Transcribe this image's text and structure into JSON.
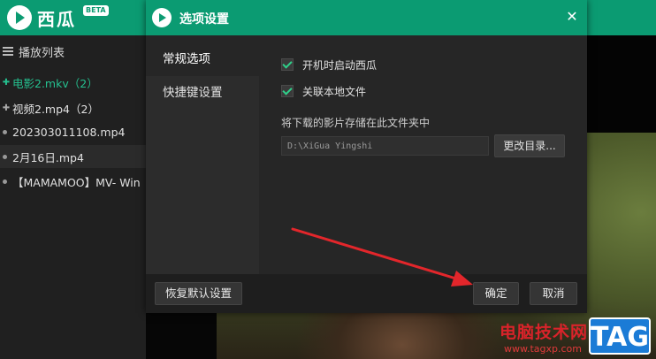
{
  "app": {
    "name": "西瓜",
    "beta": "BETA"
  },
  "playlist": {
    "title": "播放列表",
    "items": [
      {
        "label": "电影2.mkv（2）",
        "type": "folder",
        "active": true
      },
      {
        "label": "视频2.mp4（2）",
        "type": "folder"
      },
      {
        "label": "202303011108.mp4",
        "type": "file"
      },
      {
        "label": "2月16日.mp4",
        "type": "file",
        "selected": true
      },
      {
        "label": "【MAMAMOO】MV- Win",
        "type": "file"
      }
    ]
  },
  "dialog": {
    "title": "选项设置",
    "close": "✕",
    "nav": [
      {
        "label": "常规选项",
        "active": true
      },
      {
        "label": "快捷键设置"
      }
    ],
    "options": {
      "startup_label": "开机时启动西瓜",
      "startup_checked": true,
      "assoc_label": "关联本地文件",
      "assoc_checked": true,
      "path_label": "将下载的影片存储在此文件夹中",
      "path_value": "D:\\XiGua Yingshi",
      "change_dir_label": "更改目录..."
    },
    "footer": {
      "restore_label": "恢复默认设置",
      "ok_label": "确定",
      "cancel_label": "取消"
    }
  },
  "watermark": {
    "site": "电脑技术网",
    "url": "www.tagxp.com",
    "tag": "TAG"
  },
  "colors": {
    "brand_green": "#0b9b72",
    "active_text": "#25c08f",
    "annotation_red": "#e3262b"
  }
}
